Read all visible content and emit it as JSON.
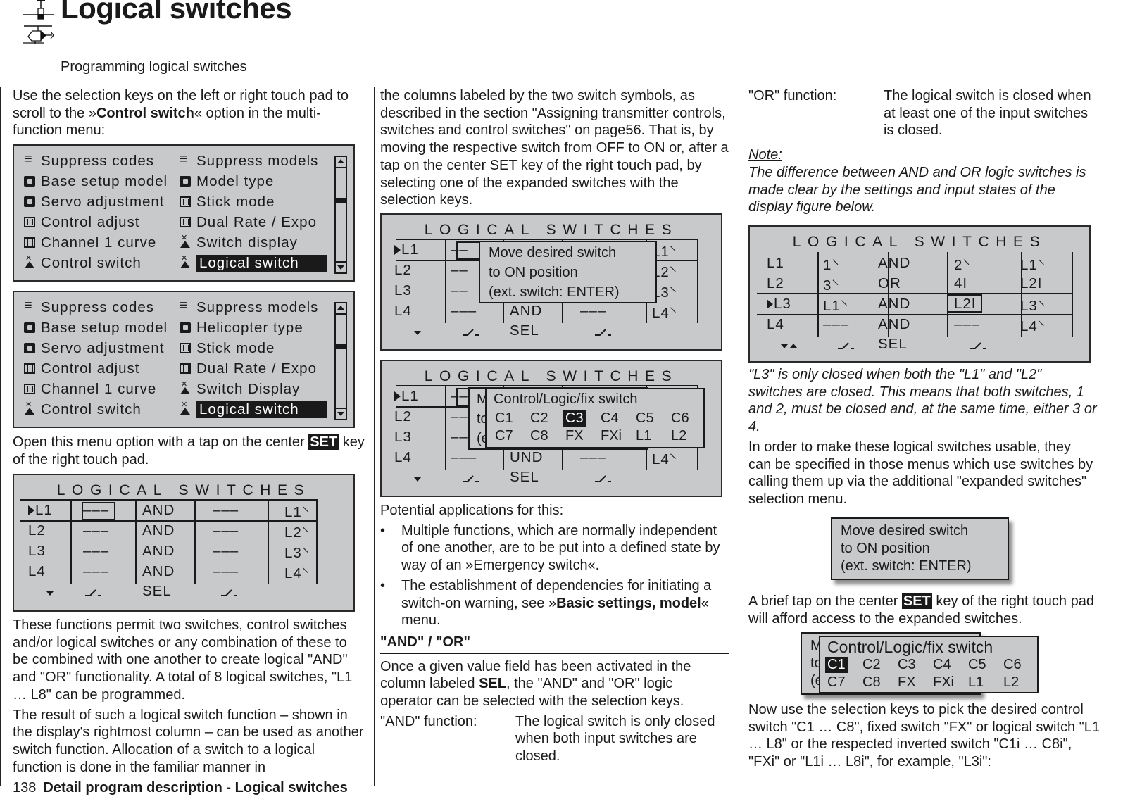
{
  "header": {
    "title": "Logical switches",
    "subtitle": "Programming logical switches",
    "logo_icon": "helicopter-and-plane-icon"
  },
  "col1": {
    "p1_a": "Use the selection keys on the left or right touch pad to scroll to the »",
    "p1_bold": "Control switch",
    "p1_b": "« option in the multi-function menu:",
    "menu1": {
      "left": [
        {
          "icon": "list",
          "label": "Suppress codes"
        },
        {
          "icon": "model",
          "label": "Base setup model"
        },
        {
          "icon": "model",
          "label": "Servo adjustment"
        },
        {
          "icon": "frame",
          "label": "Control adjust"
        },
        {
          "icon": "frame",
          "label": "Channel 1 curve"
        },
        {
          "icon": "switch",
          "label": "Control switch"
        }
      ],
      "right": [
        {
          "icon": "list",
          "label": "Suppress models"
        },
        {
          "icon": "model",
          "label": "Model type"
        },
        {
          "icon": "frame",
          "label": "Stick mode"
        },
        {
          "icon": "frame",
          "label": "Dual Rate / Expo"
        },
        {
          "icon": "switch",
          "label": "Switch display"
        },
        {
          "icon": "switch",
          "label": "Logical switch",
          "selected": true
        }
      ]
    },
    "menu2": {
      "left": [
        {
          "icon": "list",
          "label": "Suppress codes"
        },
        {
          "icon": "model",
          "label": "Base setup model"
        },
        {
          "icon": "model",
          "label": "Servo adjustment"
        },
        {
          "icon": "frame",
          "label": "Control adjust"
        },
        {
          "icon": "frame",
          "label": "Channel 1 curve"
        },
        {
          "icon": "switch",
          "label": "Control switch"
        }
      ],
      "right": [
        {
          "icon": "list",
          "label": "Suppress models"
        },
        {
          "icon": "model",
          "label": "Helicopter type"
        },
        {
          "icon": "frame",
          "label": "Stick mode"
        },
        {
          "icon": "frame",
          "label": "Dual Rate / Expo"
        },
        {
          "icon": "switch",
          "label": "Switch Display"
        },
        {
          "icon": "switch",
          "label": "Logical switch",
          "selected": true
        }
      ]
    },
    "p2_a": "Open this menu option with a tap on the center ",
    "p2_key": "SET",
    "p2_b": " key of the right touch pad.",
    "p3": "These functions permit two switches, control switches and/or logical switches or any combination of these to be combined with one another to create logical \"AND\" and \"OR\" functionality. A total of 8 logical switches, \"L1 … L8\" can be programmed.",
    "p4": "The result of such a logical switch function – shown in the display's rightmost column – can be used as another switch function. Allocation of a switch to a logical function is done in the familiar manner in"
  },
  "lcd_title": "LOGICAL SWITCHES",
  "sel_label": "SEL",
  "screen_a": {
    "rows": [
      {
        "name": "L1",
        "s1": "–––",
        "op": "AND",
        "s2": "–––",
        "out": "L1⸌"
      },
      {
        "name": "L2",
        "s1": "–––",
        "op": "AND",
        "s2": "–––",
        "out": "L2⸌"
      },
      {
        "name": "L3",
        "s1": "–––",
        "op": "AND",
        "s2": "–––",
        "out": "L3⸌"
      },
      {
        "name": "L4",
        "s1": "–––",
        "op": "AND",
        "s2": "–––",
        "out": "L4⸌"
      }
    ]
  },
  "col2": {
    "p1": "the columns labeled by the two switch symbols, as described in the section \"Assigning transmitter controls, switches and control switches\" on page56. That is, by moving the respective switch from OFF to ON or, after a tap on the center SET key of the right touch pad, by selecting one of the expanded switches with the selection keys.",
    "screen_b": {
      "rows": [
        {
          "name": "L1",
          "s1": "––",
          "out": "L1⸌"
        },
        {
          "name": "L2",
          "s1": "––",
          "out": "L2⸌"
        },
        {
          "name": "L3",
          "s1": "––",
          "out": "L3⸌"
        },
        {
          "name": "L4",
          "s1": "–––",
          "op": "AND",
          "s2": "–––",
          "out": "L4⸌"
        }
      ],
      "popup": [
        "Move desired switch",
        "to  ON  position",
        "(ext.  switch:  ENTER)"
      ]
    },
    "screen_c": {
      "rows": [
        {
          "name": "L1",
          "s1": "––"
        },
        {
          "name": "L2",
          "s1": "––"
        },
        {
          "name": "L3",
          "s1": "––"
        },
        {
          "name": "L4",
          "s1": "–––",
          "op": "UND",
          "s2": "–––",
          "out": "L4⸌"
        }
      ],
      "under_popup": [
        "M",
        "to",
        "(e"
      ],
      "popup_title": "Control/Logic/fix switch",
      "items": [
        "C1",
        "C2",
        "C3",
        "C4",
        "C5",
        "C6",
        "C7",
        "C8",
        "FX",
        "FXi",
        "L1",
        "L2"
      ],
      "selected": "C3"
    },
    "p2": "Potential applications for this:",
    "bullets": [
      {
        "text_a": "Multiple functions, which are normally independent of one another, are to be put into a defined state by way of an »Emergency switch«.",
        "bold": "",
        "text_b": ""
      },
      {
        "text_a": "The establishment of dependencies for initiating a switch-on warning, see »",
        "bold": "Basic settings, model",
        "text_b": "« menu."
      }
    ],
    "section_heading": "\"AND\" / \"OR\"",
    "p3_a": "Once a given value field has been activated in the column labeled ",
    "p3_bold": "SEL",
    "p3_b": ", the \"AND\" and \"OR\" logic operator can be selected with the selection keys.",
    "and_label": "\"AND\" function:",
    "and_text": "The logical switch is only closed when both input switches are closed."
  },
  "col3": {
    "or_label": "\"OR\" function:",
    "or_text": "The logical switch is closed when at least one of the input switches is closed.",
    "note_heading": "Note:",
    "note_text": "The difference between AND and OR logic switches is made clear by the settings and input states of the display figure below.",
    "screen_d": {
      "rows": [
        {
          "name": "L1",
          "s1": "1⸌",
          "op": "AND",
          "s2": "2⸌",
          "out": "L1⸌"
        },
        {
          "name": "L2",
          "s1": "3⸌",
          "op": "OR",
          "s2": "4I",
          "out": "L2I"
        },
        {
          "name": "L3",
          "s1": "L1⸌",
          "op": "AND",
          "s2": "L2I",
          "out": "L3⸌"
        },
        {
          "name": "L4",
          "s1": "–––",
          "op": "AND",
          "s2": "–––",
          "out": "L4⸌"
        }
      ]
    },
    "caption": "\"L3\" is only closed when both the \"L1\" and \"L2\" switches are closed. This means that both switches, 1 and 2, must be closed and, at the same time, either 3 or 4.",
    "p1": "In order to make these logical switches usable, they can be specified in those menus which use switches by calling them up via the additional \"expanded switches\" selection menu.",
    "popup": [
      "Move desired switch",
      "to  ON  position",
      "(ext.  switch:  ENTER)"
    ],
    "p2_a": "A brief tap on the center ",
    "p2_key": "SET",
    "p2_b": " key of the right touch pad will afford access to the expanded switches.",
    "popup2": {
      "under": [
        "M",
        "to",
        "(e"
      ],
      "title": "Control/Logic/fix switch",
      "items": [
        "C1",
        "C2",
        "C3",
        "C4",
        "C5",
        "C6",
        "C7",
        "C8",
        "FX",
        "FXi",
        "L1",
        "L2"
      ],
      "selected": "C1"
    },
    "p3": "Now use the selection keys to pick the desired control switch \"C1 … C8\", fixed switch \"FX\" or logical switch \"L1 … L8\" or the respected inverted switch \"C1i … C8i\", \"FXi\" or \"L1i … L8i\", for example, \"L3i\":"
  },
  "footer": {
    "page": "138",
    "section": "Detail program description - Logical switches"
  }
}
